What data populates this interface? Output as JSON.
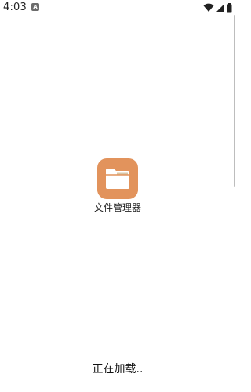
{
  "status_bar": {
    "time": "4:03",
    "notification_icon": "A",
    "icons": [
      "wifi-icon",
      "cellular-signal-icon",
      "battery-icon"
    ]
  },
  "app": {
    "name": "文件管理器",
    "icon": "folder-icon",
    "icon_color": "#e2935c"
  },
  "loading": {
    "text": "正在加载.."
  }
}
